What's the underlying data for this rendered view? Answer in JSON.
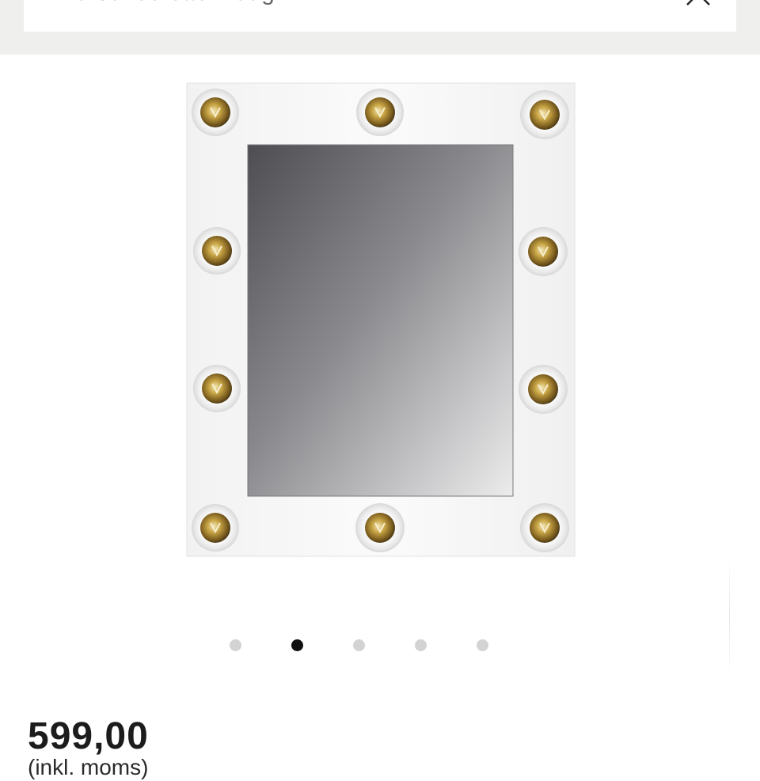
{
  "search": {
    "query_text": "Hva ser du etter i dag?"
  },
  "icons": {
    "clear": "close-icon"
  },
  "gallery": {
    "image_description": "vanity-mirror-product-photo",
    "slide_count": 5,
    "active_slide": 2
  },
  "product": {
    "price": "599,00",
    "vat_note": "(inkl. moms)"
  },
  "colors": {
    "header_band": "#efefed",
    "dot_inactive": "#d3d3d3",
    "dot_active": "#111111",
    "price_text": "#1c1c1c"
  }
}
